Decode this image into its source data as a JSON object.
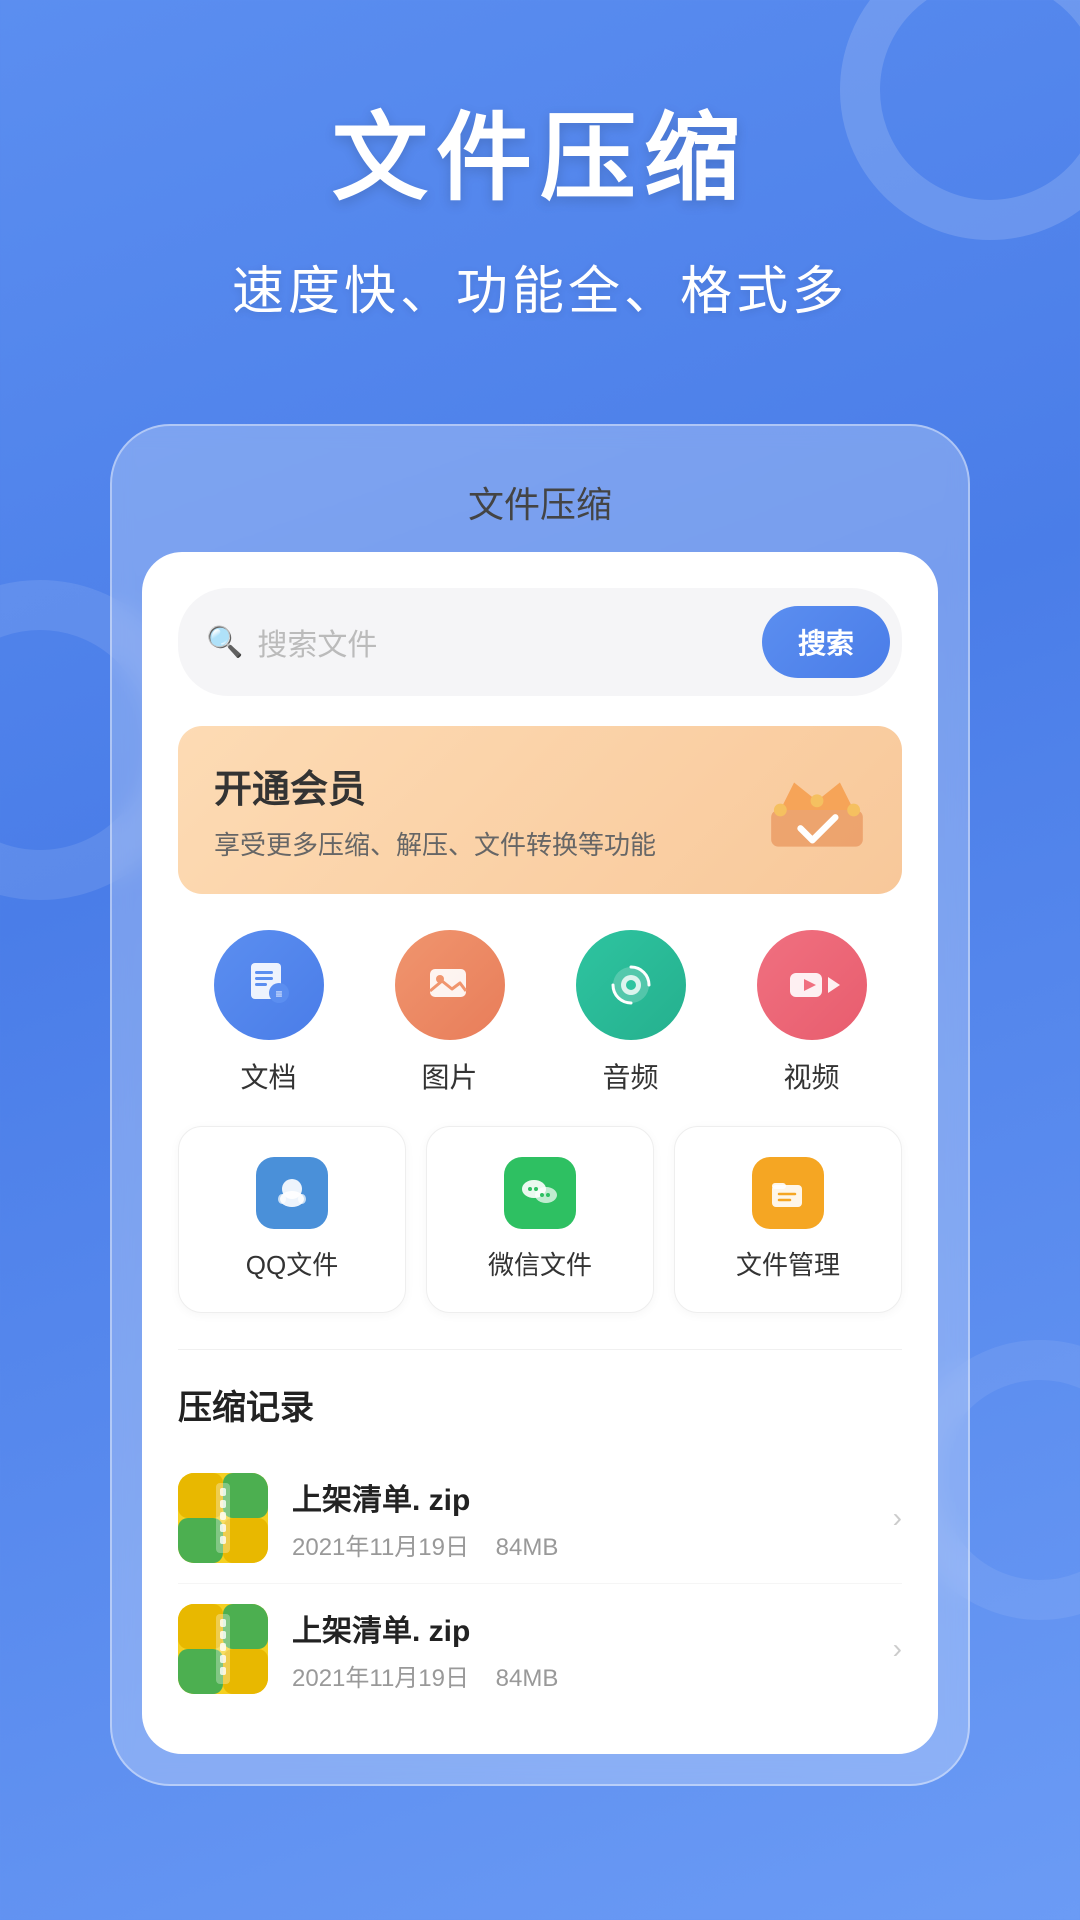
{
  "hero": {
    "title": "文件压缩",
    "subtitle": "速度快、功能全、格式多"
  },
  "phone_header": {
    "title": "文件压缩"
  },
  "search": {
    "placeholder": "搜索文件",
    "button_label": "搜索"
  },
  "vip": {
    "title": "开通会员",
    "description": "享受更多压缩、解压、文件转换等功能"
  },
  "features": [
    {
      "id": "doc",
      "label": "文档",
      "color_class": "circle-blue",
      "icon": "doc"
    },
    {
      "id": "image",
      "label": "图片",
      "color_class": "circle-orange",
      "icon": "image"
    },
    {
      "id": "audio",
      "label": "音频",
      "color_class": "circle-teal",
      "icon": "audio"
    },
    {
      "id": "video",
      "label": "视频",
      "color_class": "circle-pink",
      "icon": "video"
    }
  ],
  "tools": [
    {
      "id": "qq",
      "label": "QQ文件",
      "color": "icon-qq"
    },
    {
      "id": "wechat",
      "label": "微信文件",
      "color": "icon-wechat"
    },
    {
      "id": "files",
      "label": "文件管理",
      "color": "icon-files"
    }
  ],
  "records": {
    "title": "压缩记录",
    "items": [
      {
        "name": "上架清单. zip",
        "date": "2021年11月19日",
        "size": "84MB"
      },
      {
        "name": "上架清单. zip",
        "date": "2021年11月19日",
        "size": "84MB"
      }
    ]
  }
}
